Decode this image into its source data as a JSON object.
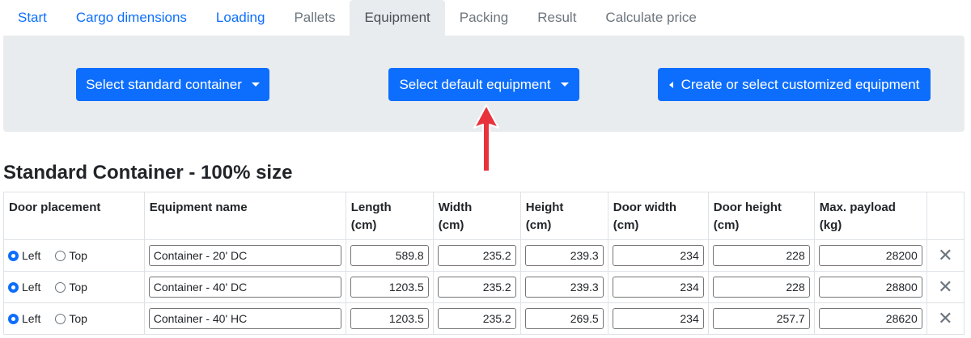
{
  "tabs": [
    {
      "label": "Start",
      "state": "link"
    },
    {
      "label": "Cargo dimensions",
      "state": "link"
    },
    {
      "label": "Loading",
      "state": "link"
    },
    {
      "label": "Pallets",
      "state": "muted"
    },
    {
      "label": "Equipment",
      "state": "active"
    },
    {
      "label": "Packing",
      "state": "muted"
    },
    {
      "label": "Result",
      "state": "muted"
    },
    {
      "label": "Calculate price",
      "state": "muted"
    }
  ],
  "buttons": {
    "standard_container": "Select standard container",
    "default_equipment": "Select default equipment",
    "customized_equipment": "Create or select customized equipment"
  },
  "heading": "Standard Container - 100% size",
  "table": {
    "headers": {
      "door_placement": "Door placement",
      "equipment_name": "Equipment name",
      "length_1": "Length",
      "length_2": "(cm)",
      "width_1": "Width",
      "width_2": "(cm)",
      "height_1": "Height",
      "height_2": "(cm)",
      "door_width_1": "Door width",
      "door_width_2": "(cm)",
      "door_height_1": "Door height",
      "door_height_2": "(cm)",
      "payload_1": "Max. payload",
      "payload_2": "(kg)"
    },
    "radio_left": "Left",
    "radio_top": "Top",
    "rows": [
      {
        "door": "Left",
        "name": "Container - 20' DC",
        "length": "589.8",
        "width": "235.2",
        "height": "239.3",
        "door_width": "234",
        "door_height": "228",
        "payload": "28200"
      },
      {
        "door": "Left",
        "name": "Container - 40' DC",
        "length": "1203.5",
        "width": "235.2",
        "height": "239.3",
        "door_width": "234",
        "door_height": "228",
        "payload": "28800"
      },
      {
        "door": "Left",
        "name": "Container - 40' HC",
        "length": "1203.5",
        "width": "235.2",
        "height": "269.5",
        "door_width": "234",
        "door_height": "257.7",
        "payload": "28620"
      }
    ],
    "delete_icon": "close-icon"
  },
  "colors": {
    "primary": "#0d6efd",
    "panel": "#e9ecef",
    "muted": "#6c757d",
    "arrow": "#e8323c"
  }
}
